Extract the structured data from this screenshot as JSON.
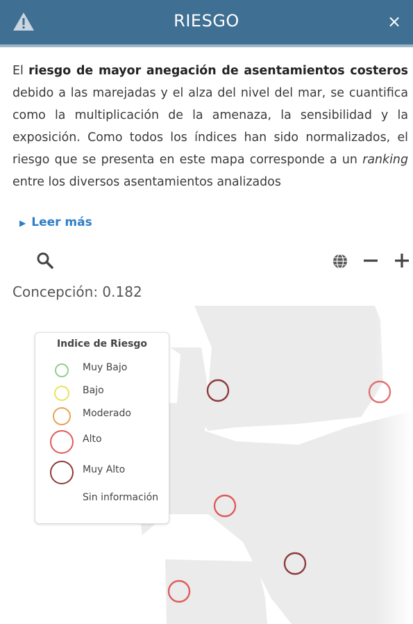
{
  "header": {
    "title": "RIESGO",
    "close_label": "×",
    "bg_color": "#3f6f93"
  },
  "description": {
    "prefix": "El ",
    "bold": "riesgo de mayor anegación de asentamientos costeros",
    "middle": " debido a las marejadas y el alza del nivel del mar, se cuantifica como la multiplicación de la amenaza, la sensibilidad y la exposición. Como todos los índices han sido normalizados, el riesgo que se presenta en este mapa corresponde a un ",
    "italic": "ranking",
    "suffix": " entre los diversos asentamientos analizados"
  },
  "read_more": {
    "label": "Leer más",
    "color": "#2d7ec6"
  },
  "toolbar": {
    "search_icon": "search-icon",
    "globe_icon": "globe-icon",
    "zoom_out_icon": "minus-icon",
    "zoom_in_icon": "plus-icon"
  },
  "readout": "Concepción: 0.182",
  "legend": {
    "title": "Indice de Riesgo",
    "items": [
      {
        "label": "Muy Bajo",
        "color": "#8fd08f"
      },
      {
        "label": "Bajo",
        "color": "#e8e35a"
      },
      {
        "label": "Moderado",
        "color": "#e8a25a"
      },
      {
        "label": "Alto",
        "color": "#e05a5a"
      },
      {
        "label": "Muy Alto",
        "color": "#8b3a3a"
      },
      {
        "label": "Sin información",
        "color": ""
      }
    ]
  },
  "map_points": [
    {
      "level": "Muy Alto",
      "color": "#8b3a3a"
    },
    {
      "level": "Alto",
      "color": "#e07070"
    },
    {
      "level": "Alto",
      "color": "#e05a5a"
    },
    {
      "level": "Muy Alto",
      "color": "#8b3a3a"
    },
    {
      "level": "Alto",
      "color": "#e05a5a"
    }
  ]
}
